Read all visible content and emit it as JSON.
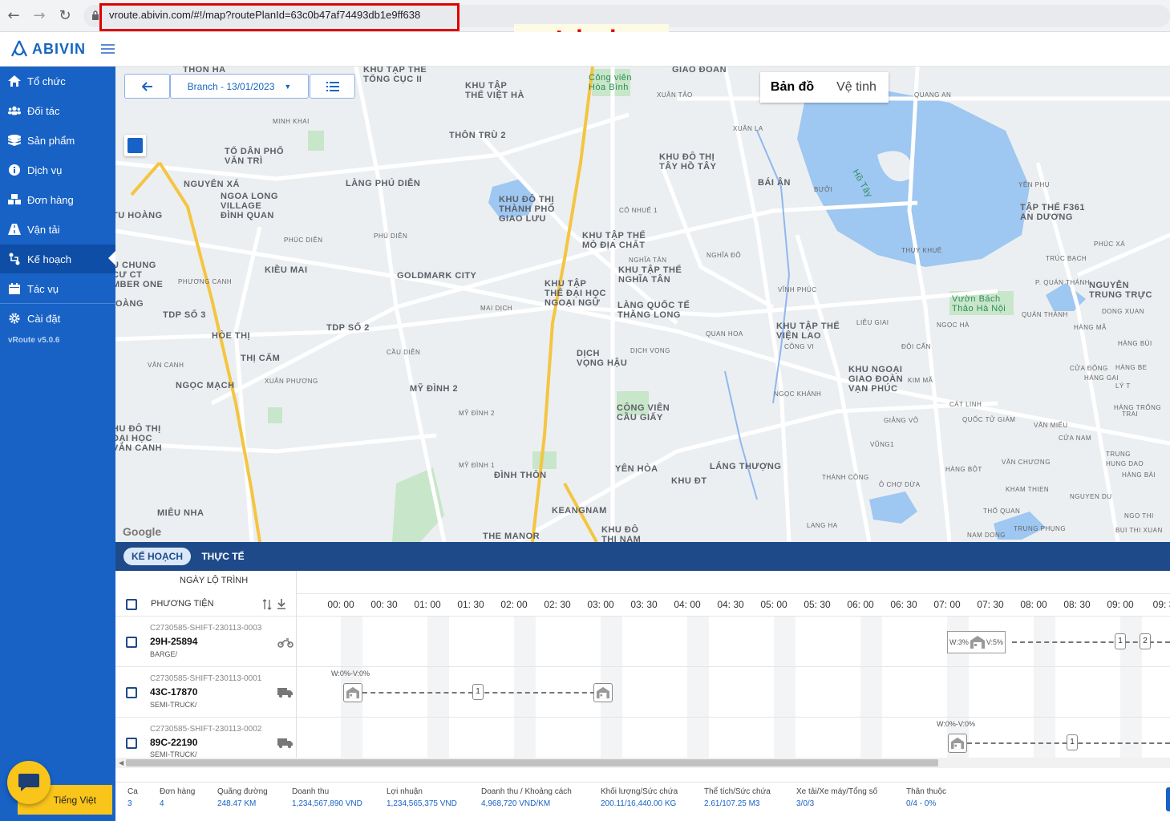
{
  "browser": {
    "url": "vroute.abivin.com/#!/map?routePlanId=63c0b47af74493db1e9ff638",
    "annotation": "Link URL"
  },
  "app": {
    "logo": "ABIVIN",
    "version": "vRoute v5.0.6"
  },
  "sidebar": {
    "items": [
      {
        "label": "Tổ chức",
        "icon": "home-icon"
      },
      {
        "label": "Đối tác",
        "icon": "users-icon"
      },
      {
        "label": "Sản phẩm",
        "icon": "boxes-icon"
      },
      {
        "label": "Dịch vụ",
        "icon": "info-icon"
      },
      {
        "label": "Đơn hàng",
        "icon": "cubes-icon"
      },
      {
        "label": "Vận tải",
        "icon": "road-icon"
      },
      {
        "label": "Kế hoạch",
        "icon": "route-icon",
        "active": true
      },
      {
        "label": "Tác vụ",
        "icon": "calendar-icon"
      },
      {
        "label": "Cài đặt",
        "icon": "gear-icon"
      }
    ]
  },
  "map": {
    "branch_select": "Branch - 13/01/2023",
    "map_type": {
      "map": "Bản đồ",
      "satellite": "Vệ tinh"
    },
    "google": "Google",
    "lake_label": "Hồ Tây"
  },
  "tabs": {
    "plan": "KẾ HOẠCH",
    "actual": "THỰC TẾ"
  },
  "gantt": {
    "header_date": "NGÀY LỘ TRÌNH",
    "header_vehicle": "PHƯƠNG TIỆN",
    "times": [
      "00: 00",
      "00: 30",
      "01: 00",
      "01: 30",
      "02: 00",
      "02: 30",
      "03: 00",
      "03: 30",
      "04: 00",
      "04: 30",
      "05: 00",
      "05: 30",
      "06: 00",
      "06: 30",
      "07: 00",
      "07: 30",
      "08: 00",
      "08: 30",
      "09: 00",
      "09: 3"
    ],
    "rows": [
      {
        "shift": "C2730585-SHIFT-230113-0003",
        "plate": "29H-25894",
        "type": "BARGE/",
        "icon": "motorbike-icon",
        "wv": [
          "W:3%",
          "V:5%"
        ],
        "stops": [
          "1",
          "2"
        ]
      },
      {
        "shift": "C2730585-SHIFT-230113-0001",
        "plate": "43C-17870",
        "type": "SEMI-TRUCK/",
        "icon": "truck-icon",
        "wv": "W:0%-V:0%",
        "stops": [
          "1"
        ]
      },
      {
        "shift": "C2730585-SHIFT-230113-0002",
        "plate": "89C-22190",
        "type": "SEMI-TRUCK/",
        "icon": "truck-icon",
        "wv": "W:0%-V:0%",
        "stops": [
          "1"
        ]
      }
    ]
  },
  "footer": {
    "stats": [
      {
        "label": "Ca",
        "value": "3"
      },
      {
        "label": "Đơn hàng",
        "value": "4"
      },
      {
        "label": "Quãng đường",
        "value": "248.47 KM"
      },
      {
        "label": "Doanh thu",
        "value": "1,234,567,890 VND"
      },
      {
        "label": "Lợi nhuận",
        "value": "1,234,565,375 VND"
      },
      {
        "label": "Doanh thu / Khoảng cách",
        "value": "4,968,720 VND/KM"
      },
      {
        "label": "Khối lượng/Sức chứa",
        "value": "200.11/16,440.00 KG"
      },
      {
        "label": "Thể tích/Sức chứa",
        "value": "2.61/107.25 M3"
      },
      {
        "label": "Xe tải/Xe máy/Tổng số",
        "value": "3/0/3"
      },
      {
        "label": "Thân thuộc",
        "value": "0/4 - 0%"
      }
    ]
  },
  "language": "Tiếng Việt",
  "colors": {
    "sidebar": "#1862c6",
    "tabbar": "#1e4a8a",
    "accent": "#f9c51b",
    "highlight": "#e00000"
  }
}
